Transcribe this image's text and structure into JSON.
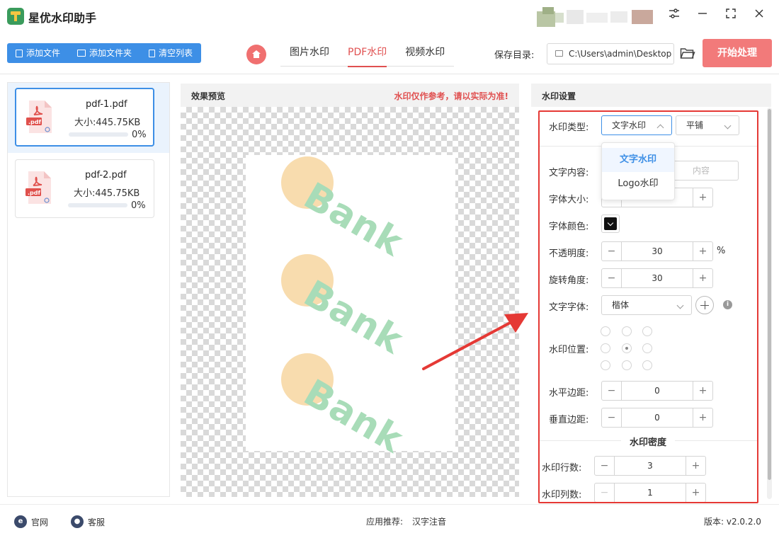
{
  "app": {
    "title": "星优水印助手"
  },
  "window_controls": {
    "settings_icon": "sliders-icon",
    "minimize": "—",
    "maximize": "⛶",
    "close": "✕"
  },
  "toolbar": {
    "add_file": "添加文件",
    "add_folder": "添加文件夹",
    "clear_list": "清空列表",
    "tabs": [
      {
        "label": "图片水印",
        "active": false
      },
      {
        "label": "PDF水印",
        "active": true
      },
      {
        "label": "视频水印",
        "active": false
      }
    ],
    "save_label": "保存目录:",
    "save_path": "C:\\Users\\admin\\Desktop",
    "start_button": "开始处理",
    "accent": "#3d8fe6",
    "start_color": "#f27a7a"
  },
  "files": [
    {
      "name": "pdf-1.pdf",
      "size": "大小:445.75KB",
      "progress": "0%",
      "progress_value": 0,
      "selected": true
    },
    {
      "name": "pdf-2.pdf",
      "size": "大小:445.75KB",
      "progress": "0%",
      "progress_value": 0,
      "selected": false
    }
  ],
  "preview": {
    "title": "效果预览",
    "tip": "水印仅作参考，请以实际为准!",
    "watermark_text": "Bank"
  },
  "settings": {
    "title": "水印设置",
    "type_label": "水印类型:",
    "type_value": "文字水印",
    "layout_value": "平铺",
    "dropdown": {
      "options": [
        "文字水印",
        "Logo水印"
      ],
      "active_index": 0
    },
    "text_content_label": "文字内容:",
    "text_content_placeholder": "内容",
    "font_size_label": "字体大小:",
    "font_color_label": "字体颜色:",
    "font_color": "#111111",
    "opacity_label": "不透明度:",
    "opacity_value": "30",
    "opacity_unit": "%",
    "rotation_label": "旋转角度:",
    "rotation_value": "30",
    "font_family_label": "文字字体:",
    "font_family_value": "楷体",
    "info_icon": "i",
    "position_label": "水印位置:",
    "position_selected": "center",
    "h_margin_label": "水平边距:",
    "h_margin_value": "0",
    "v_margin_label": "垂直边距:",
    "v_margin_value": "0",
    "density_title": "水印密度",
    "rows_label": "水印行数:",
    "rows_value": "3",
    "cols_label": "水印列数:",
    "cols_value": "1",
    "minus": "−",
    "plus": "+"
  },
  "statusbar": {
    "website": "官网",
    "website_icon": "e",
    "service": "客服",
    "service_icon": "●",
    "recommend_label": "应用推荐:",
    "recommend_app": "汉字注音",
    "version": "版本: v2.0.2.0"
  }
}
